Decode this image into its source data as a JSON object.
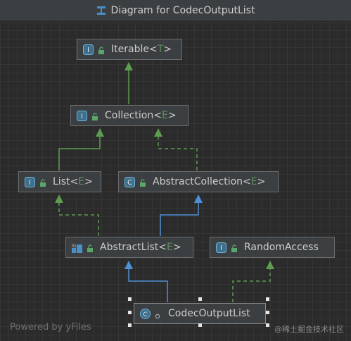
{
  "window": {
    "title": "Diagram for CodecOutputList"
  },
  "nodes": {
    "iterable": {
      "name": "Iterable",
      "type_param": "T",
      "kind": "interface"
    },
    "collection": {
      "name": "Collection",
      "type_param": "E",
      "kind": "interface"
    },
    "list": {
      "name": "List",
      "type_param": "E",
      "kind": "interface"
    },
    "abstract_collection": {
      "name": "AbstractCollection",
      "type_param": "E",
      "kind": "abstract-class"
    },
    "abstract_list": {
      "name": "AbstractList",
      "type_param": "E",
      "kind": "abstract-class"
    },
    "random_access": {
      "name": "RandomAccess",
      "type_param": "",
      "kind": "interface"
    },
    "codec_output_list": {
      "name": "CodecOutputList",
      "type_param": "",
      "kind": "class",
      "selected": true
    }
  },
  "edges": [
    {
      "from": "Collection",
      "to": "Iterable",
      "kind": "extends"
    },
    {
      "from": "List",
      "to": "Collection",
      "kind": "extends"
    },
    {
      "from": "AbstractCollection",
      "to": "Collection",
      "kind": "implements"
    },
    {
      "from": "AbstractList",
      "to": "List",
      "kind": "implements"
    },
    {
      "from": "AbstractList",
      "to": "AbstractCollection",
      "kind": "extends-class"
    },
    {
      "from": "CodecOutputList",
      "to": "AbstractList",
      "kind": "extends-class"
    },
    {
      "from": "CodecOutputList",
      "to": "RandomAccess",
      "kind": "implements"
    }
  ],
  "colors": {
    "extends_interface": "#5e9c4f",
    "implements": "#5e9c4f",
    "extends_class": "#4f8fd6",
    "node_bg": "#3c3f41",
    "canvas_bg": "#2b2b2b"
  },
  "footer": {
    "text": "Powered by yFiles"
  },
  "watermark": {
    "text": "@稀土掘金技术社区"
  },
  "punct": {
    "lt": "<",
    "gt": ">"
  }
}
